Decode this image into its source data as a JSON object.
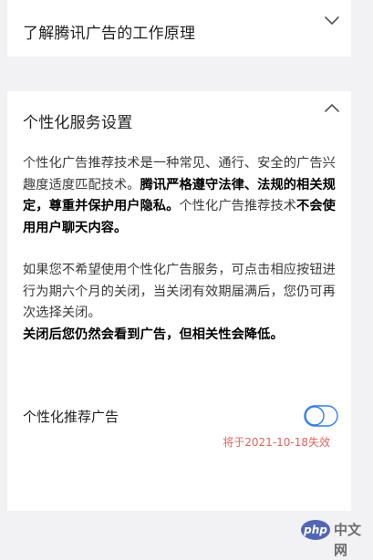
{
  "top_section": {
    "title": "了解腾讯广告的工作原理",
    "chevron_icon": "chevron-down-icon"
  },
  "personalization": {
    "title": "个性化服务设置",
    "chevron_icon": "chevron-up-icon",
    "para1": {
      "normal_1": "个性化广告推荐技术是一种常见、通行、安全的广告兴趣度适度匹配技术。",
      "bold_1": "腾讯严格遵守法律、法规的相关规定，尊重并保护用户隐私。",
      "normal_2": "个性化广告推荐技术",
      "bold_2": "不会使用用户聊天内容。"
    },
    "para2": {
      "normal": "如果您不希望使用个性化广告服务，可点击相应按钮进行为期六个月的关闭，当关闭有效期届满后，您仍可再次选择关闭。",
      "bold": "关闭后您仍然会看到广告，但相关性会降低。"
    },
    "toggle": {
      "label": "个性化推荐广告",
      "state": "off",
      "accent_color": "#2e7cf6"
    },
    "expire_text": "将于2021-10-18失效",
    "expire_color": "#e0645c"
  },
  "watermark": {
    "logo_text": "php",
    "text": "中文网"
  }
}
